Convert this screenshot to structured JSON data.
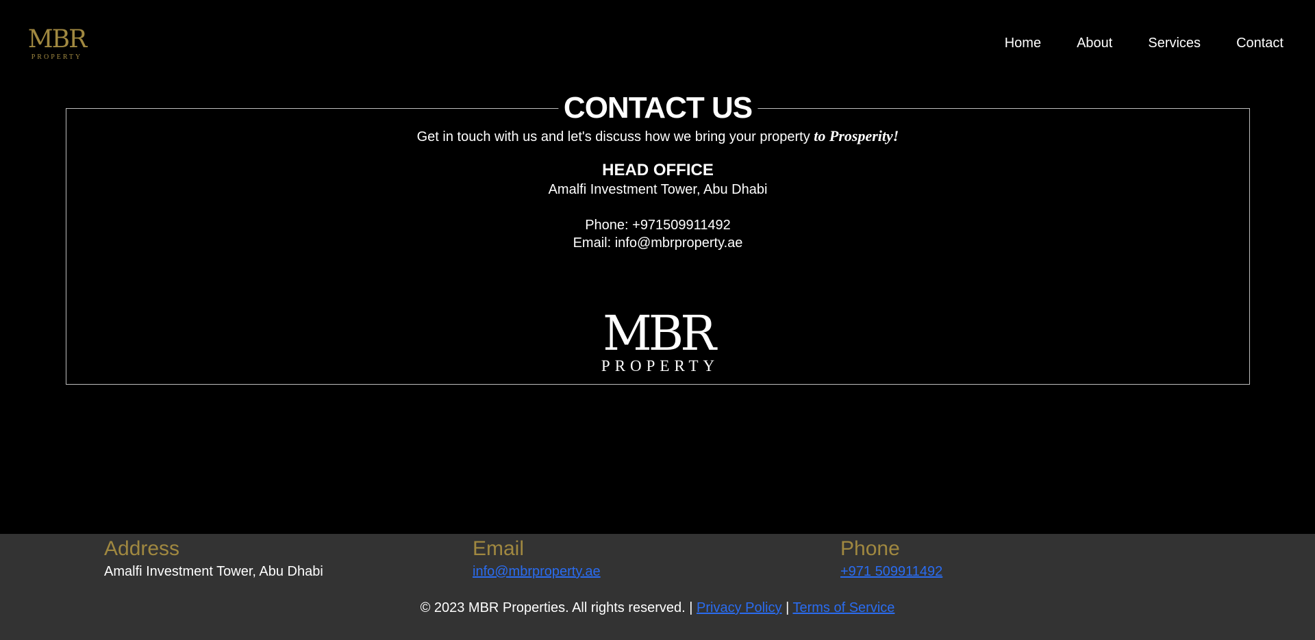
{
  "header": {
    "logo": {
      "mark": "MBR",
      "word": "PROPERTY",
      "color": "#a08840"
    },
    "nav": [
      {
        "label": "Home"
      },
      {
        "label": "About"
      },
      {
        "label": "Services"
      },
      {
        "label": "Contact"
      }
    ]
  },
  "contact": {
    "title": "CONTACT US",
    "tagline": "Get in touch with us and let's discuss how we bring your property",
    "tagline_emphasis": "to Prosperity!",
    "office_heading": "HEAD OFFICE",
    "office_address": "Amalfi Investment Tower, Abu Dhabi",
    "phone_line": "Phone: +971509911492",
    "email_line": "Email: info@mbrproperty.ae",
    "logo": {
      "mark": "MBR",
      "word": "PROPERTY"
    }
  },
  "footer": {
    "background": "#333333",
    "heading_color": "#a08840",
    "link_color": "#2a6cf0",
    "address": {
      "heading": "Address",
      "value": "Amalfi Investment Tower, Abu Dhabi"
    },
    "email": {
      "heading": "Email",
      "value": "info@mbrproperty.ae"
    },
    "phone": {
      "heading": "Phone",
      "value": "+971 509911492"
    },
    "copyright": "© 2023 MBR Properties. All rights reserved. |",
    "privacy_label": "Privacy Policy",
    "separator": "|",
    "terms_label": "Terms of Service"
  }
}
